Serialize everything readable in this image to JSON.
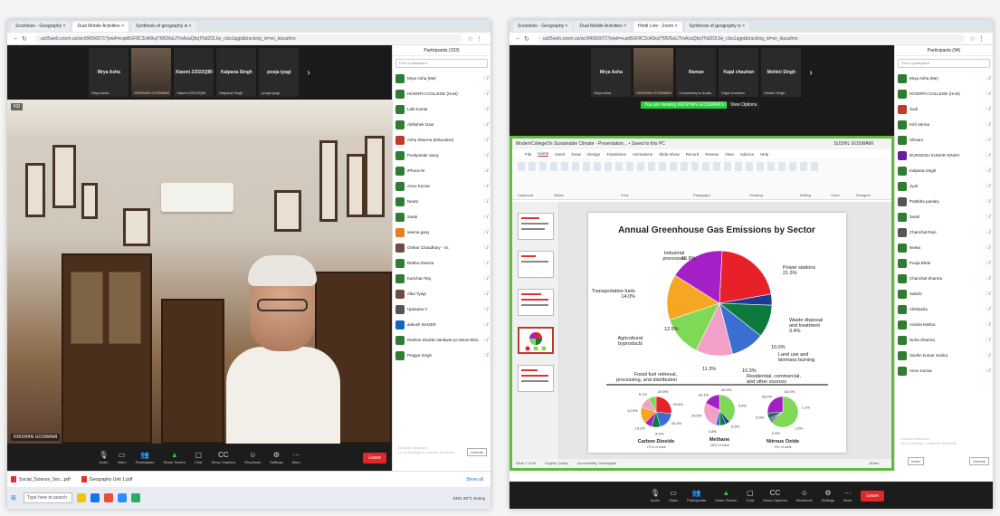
{
  "left": {
    "tabs": [
      "Scrutinize - Geography ×",
      "Dual Mobile Activities ×",
      "Synthesis of geography is ×"
    ],
    "address": "us05web.zoom.us/wc/84056071?pwd=eupt8UF8C3cA0kqTf9f2RaUTmAzaQbqTNd2DL6e_clss1agpt&tracking_id=xn_klasafmo",
    "participants_title": "Participants (103)",
    "search_placeholder": "Find a participant",
    "thumbs": [
      {
        "name": "Mrya Asha",
        "label": "Mrya Asha"
      },
      {
        "name": "",
        "label": "KRISHAN GOSWAMI",
        "video": true
      },
      {
        "name": "Xiaomi 22022Q80",
        "label": "Xiaomi 22022Q80"
      },
      {
        "name": "Kalpana Singh",
        "label": "Kalpana Singh"
      },
      {
        "name": "pooja tyagi",
        "label": "pooja tyagi"
      }
    ],
    "speaker_label": "KRISHAN GOSWAMI",
    "recording_badge": "HD",
    "participants": [
      {
        "name": "Mrya Asha (Me)",
        "color": "#2e7d32"
      },
      {
        "name": "HOGRPH COLLEGE (Host)",
        "color": "#2e7d32"
      },
      {
        "name": "Lalit Kumar",
        "color": "#2e7d32"
      },
      {
        "name": "Abhishek Gaur",
        "color": "#2e7d32"
      },
      {
        "name": "Asha Sharma (Education)",
        "color": "#c0392b"
      },
      {
        "name": "Pushpinder Saroj",
        "color": "#2e7d32"
      },
      {
        "name": "iPhone M",
        "color": "#2e7d32"
      },
      {
        "name": "Annu Kumar",
        "color": "#2e7d32"
      },
      {
        "name": "Neeta",
        "color": "#2e7d32"
      },
      {
        "name": "Swati",
        "color": "#2e7d32"
      },
      {
        "name": "seema garg",
        "color": "#e67e22"
      },
      {
        "name": "Omkar Chaudhary - Sr.",
        "color": "#6d4c41"
      },
      {
        "name": "Rekha sharma",
        "color": "#2e7d32"
      },
      {
        "name": "Kanchan Raj",
        "color": "#2e7d32"
      },
      {
        "name": "Alka Tyagi",
        "color": "#6d4c41"
      },
      {
        "name": "Upasana V",
        "color": "#555555"
      },
      {
        "name": "ankush NAGER",
        "color": "#1565c0"
      },
      {
        "name": "Rashmi Shukla Haridwar-pc-Meon-BOL",
        "color": "#2e7d32"
      },
      {
        "name": "Pragya Singh",
        "color": "#2e7d32"
      }
    ],
    "unmute_label": "Unmute",
    "watermark": "Activate Windows\nGo to Settings to activate Windows.",
    "controls": [
      "Audio",
      "Video",
      "Participants",
      "Share Screen",
      "Chat",
      "Show Captions",
      "Reactions",
      "Settings",
      "More"
    ],
    "leave_label": "Leave",
    "downloads": [
      {
        "name": "Social_Science_Sec...pdf"
      },
      {
        "name": "Geography Unit 1.pdf"
      }
    ],
    "show_all": "Show all",
    "taskbar_search": "Type here to search",
    "tray": "ENG  29°C  Sunny"
  },
  "right": {
    "tabs": [
      "Scrutinize - Geography ×",
      "Dual Mobile Activities ×",
      "Hindi Live - Zoom ×",
      "Synthesis of geography is ×"
    ],
    "address": "us05web.zoom.us/wc/84056071?pwd=eupt8UF8C3cA0kqTf9f2RaUTmAzaQbqTNd2DL6e_clss1agpt&tracking_id=xn_klasafmo",
    "participants_title": "Participants (94)",
    "search_placeholder": "Find a participant",
    "thumbs": [
      {
        "name": "Mrya Asha",
        "label": "Mrya Asha"
      },
      {
        "name": "",
        "label": "KRISHAN GOSWAMI",
        "video": true
      },
      {
        "name": "Raman",
        "label": "Connecting to audio..."
      },
      {
        "name": "Kajal chauhan",
        "label": "Kajal chauhan"
      },
      {
        "name": "Mohini Singh",
        "label": "Mohini Singh"
      }
    ],
    "share_banner": "You are viewing KRISHAN GOSWAMI's screen",
    "view_options": "View Options",
    "ppt_title": "ModernCollegeOn Sustainable Climate - Presentation... • Saved to this PC",
    "ppt_user": "SUSHIL GOSWAMI",
    "ppt_menu": [
      "File",
      "Home",
      "Insert",
      "Draw",
      "Design",
      "Transitions",
      "Animations",
      "Slide Show",
      "Record",
      "Review",
      "View",
      "Add-ins",
      "Help"
    ],
    "ribbon_groups": [
      "Clipboard",
      "Slides",
      "Font",
      "Paragraph",
      "Drawing",
      "Editing",
      "Voice",
      "Designer"
    ],
    "status": [
      "Slide 7 of 26",
      "English (India)",
      "Accessibility: Investigate",
      "Notes"
    ],
    "participants": [
      {
        "name": "Mrya Asha (Me)",
        "color": "#2e7d32"
      },
      {
        "name": "HOGRPH COLLEGE (Host)",
        "color": "#2e7d32"
      },
      {
        "name": "Sudi",
        "color": "#c0392b"
      },
      {
        "name": "Kirti Verma",
        "color": "#2e7d32"
      },
      {
        "name": "Shivani",
        "color": "#2e7d32"
      },
      {
        "name": "DURGESH KUMAR SINGH",
        "color": "#6a1b9a"
      },
      {
        "name": "Kalpana Singh",
        "color": "#2e7d32"
      },
      {
        "name": "Jyoti",
        "color": "#2e7d32"
      },
      {
        "name": "Pratibha pandey",
        "color": "#555555"
      },
      {
        "name": "Swati",
        "color": "#2e7d32"
      },
      {
        "name": "Chanchal Rani",
        "color": "#555555"
      },
      {
        "name": "Neeta",
        "color": "#2e7d32"
      },
      {
        "name": "Pooja Bhati",
        "color": "#2e7d32"
      },
      {
        "name": "Chanchal Sharma",
        "color": "#2e7d32"
      },
      {
        "name": "Sakshi",
        "color": "#2e7d32"
      },
      {
        "name": "Abhilasha",
        "color": "#2e7d32"
      },
      {
        "name": "Anisha Mishra",
        "color": "#2e7d32"
      },
      {
        "name": "Neha Sharma",
        "color": "#2e7d32"
      },
      {
        "name": "Sachin kumar mishra",
        "color": "#2e7d32"
      },
      {
        "name": "Annu Kumar",
        "color": "#2e7d32"
      }
    ],
    "invite_label": "Invite",
    "unmute_label": "Unmute",
    "watermark": "Activate Windows\nGo to Settings to activate Windows.",
    "controls": [
      "Audio",
      "Video",
      "Participants",
      "Share Screen",
      "Chat",
      "Show Captions",
      "Reactions",
      "Settings",
      "More"
    ],
    "leave_label": "Leave"
  },
  "chart_data": {
    "type": "pie",
    "title": "Annual Greenhouse Gas Emissions by Sector",
    "slices": [
      {
        "label": "Power stations",
        "value": 21.3,
        "color": "#e8202a"
      },
      {
        "label": "Waste disposal and treatment",
        "value": 3.4,
        "color": "#1f3a93"
      },
      {
        "label": "Land use and biomass burning",
        "value": 10.0,
        "color": "#0b7a3c"
      },
      {
        "label": "Residential, commercial, and other sources",
        "value": 10.3,
        "color": "#3a6fd1"
      },
      {
        "label": "Fossil fuel retrieval, processing, and distribution",
        "value": 11.3,
        "color": "#f2a0c8"
      },
      {
        "label": "Agricultural byproducts",
        "value": 12.5,
        "color": "#7ed957"
      },
      {
        "label": "Transportation fuels",
        "value": 14.0,
        "color": "#f5a623"
      },
      {
        "label": "Industrial processes",
        "value": 16.8,
        "color": "#a51fc7"
      }
    ],
    "slice_labels": [
      "Power stations\n21.3%",
      "Waste disposal\nand treatment\n3.4%",
      "Land use and\nbiomass burning",
      "Residential, commercial,\nand other sources",
      "Fossil fuel retrieval,\nprocessing, and distribution",
      "Agricultural\nbyproducts",
      "Transportation fuels\n14.0%",
      "Industrial\nprocesses"
    ],
    "slice_pct_labels": [
      "10.0%",
      "10.3%",
      "11.3%",
      "12.5%",
      "16.8%"
    ],
    "sub_pies": [
      {
        "name": "Carbon Dioxide",
        "sub": "72% of total",
        "labels": [
          "29.5%",
          "20.6%",
          "10.3%",
          "8.4%",
          "19.2%",
          "12.9%",
          "9.1%"
        ]
      },
      {
        "name": "Methane",
        "sub": "18% of total",
        "labels": [
          "40.0%",
          "4.5%",
          "6.6%",
          "4.8%",
          "29.6%",
          "18.1%"
        ]
      },
      {
        "name": "Nitrous Oxide",
        "sub": "9% of total",
        "labels": [
          "62.0%",
          "1.1%",
          "1.5%",
          "2.3%",
          "5.9%",
          "26.0%"
        ]
      }
    ]
  }
}
